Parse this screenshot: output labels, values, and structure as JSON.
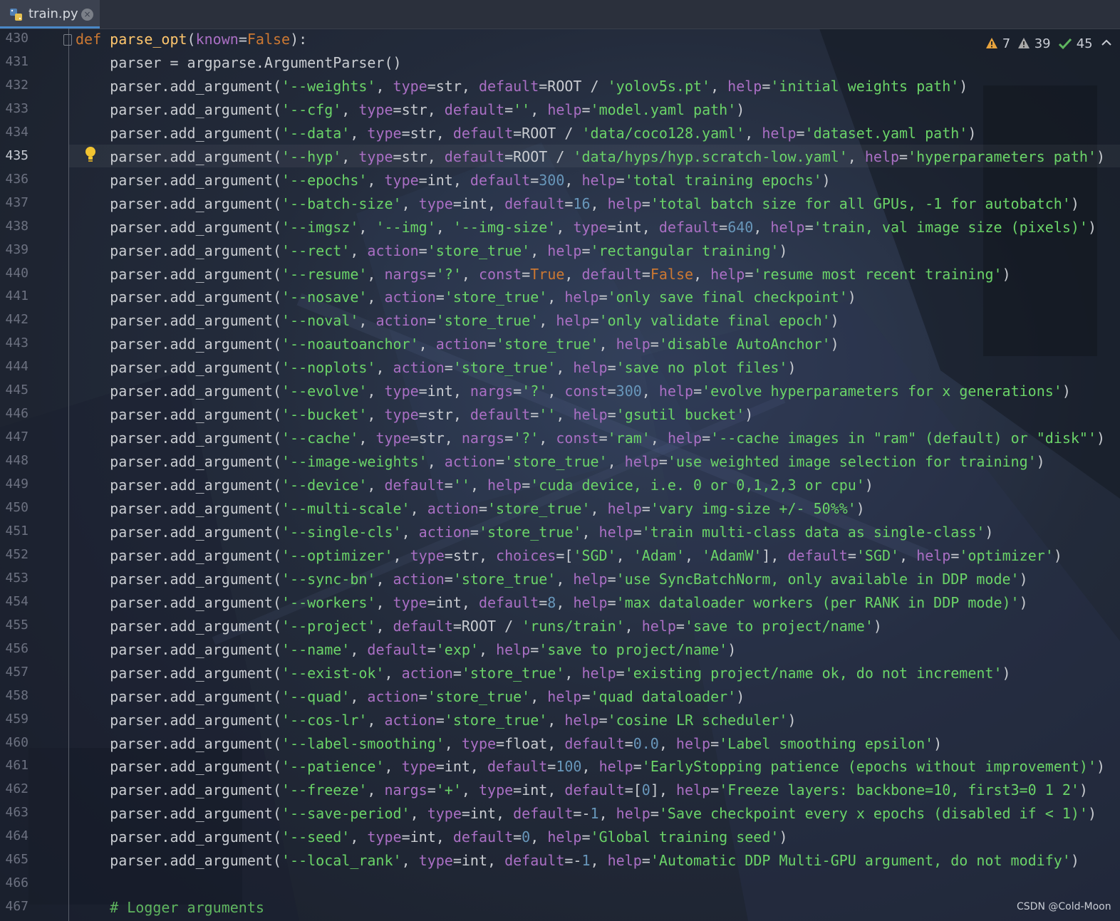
{
  "tab": {
    "file_name": "train.py",
    "close_glyph": "×",
    "icon": "python-file-icon"
  },
  "inspections": {
    "warnings": "7",
    "weak_warnings": "39",
    "typos": "45"
  },
  "watermark": "CSDN @Cold-Moon",
  "current_line": "435",
  "line_numbers": [
    "430",
    "431",
    "432",
    "433",
    "434",
    "435",
    "436",
    "437",
    "438",
    "439",
    "440",
    "441",
    "442",
    "443",
    "444",
    "445",
    "446",
    "447",
    "448",
    "449",
    "450",
    "451",
    "452",
    "453",
    "454",
    "455",
    "456",
    "457",
    "458",
    "459",
    "460",
    "461",
    "462",
    "463",
    "464",
    "465",
    "466",
    "467"
  ],
  "code_lines": [
    "def parse_opt(known=False):",
    "    parser = argparse.ArgumentParser()",
    "    parser.add_argument('--weights', type=str, default=ROOT / 'yolov5s.pt', help='initial weights path')",
    "    parser.add_argument('--cfg', type=str, default='', help='model.yaml path')",
    "    parser.add_argument('--data', type=str, default=ROOT / 'data/coco128.yaml', help='dataset.yaml path')",
    "    parser.add_argument('--hyp', type=str, default=ROOT / 'data/hyps/hyp.scratch-low.yaml', help='hyperparameters path')",
    "    parser.add_argument('--epochs', type=int, default=300, help='total training epochs')",
    "    parser.add_argument('--batch-size', type=int, default=16, help='total batch size for all GPUs, -1 for autobatch')",
    "    parser.add_argument('--imgsz', '--img', '--img-size', type=int, default=640, help='train, val image size (pixels)')",
    "    parser.add_argument('--rect', action='store_true', help='rectangular training')",
    "    parser.add_argument('--resume', nargs='?', const=True, default=False, help='resume most recent training')",
    "    parser.add_argument('--nosave', action='store_true', help='only save final checkpoint')",
    "    parser.add_argument('--noval', action='store_true', help='only validate final epoch')",
    "    parser.add_argument('--noautoanchor', action='store_true', help='disable AutoAnchor')",
    "    parser.add_argument('--noplots', action='store_true', help='save no plot files')",
    "    parser.add_argument('--evolve', type=int, nargs='?', const=300, help='evolve hyperparameters for x generations')",
    "    parser.add_argument('--bucket', type=str, default='', help='gsutil bucket')",
    "    parser.add_argument('--cache', type=str, nargs='?', const='ram', help='--cache images in \"ram\" (default) or \"disk\"')",
    "    parser.add_argument('--image-weights', action='store_true', help='use weighted image selection for training')",
    "    parser.add_argument('--device', default='', help='cuda device, i.e. 0 or 0,1,2,3 or cpu')",
    "    parser.add_argument('--multi-scale', action='store_true', help='vary img-size +/- 50%%')",
    "    parser.add_argument('--single-cls', action='store_true', help='train multi-class data as single-class')",
    "    parser.add_argument('--optimizer', type=str, choices=['SGD', 'Adam', 'AdamW'], default='SGD', help='optimizer')",
    "    parser.add_argument('--sync-bn', action='store_true', help='use SyncBatchNorm, only available in DDP mode')",
    "    parser.add_argument('--workers', type=int, default=8, help='max dataloader workers (per RANK in DDP mode)')",
    "    parser.add_argument('--project', default=ROOT / 'runs/train', help='save to project/name')",
    "    parser.add_argument('--name', default='exp', help='save to project/name')",
    "    parser.add_argument('--exist-ok', action='store_true', help='existing project/name ok, do not increment')",
    "    parser.add_argument('--quad', action='store_true', help='quad dataloader')",
    "    parser.add_argument('--cos-lr', action='store_true', help='cosine LR scheduler')",
    "    parser.add_argument('--label-smoothing', type=float, default=0.0, help='Label smoothing epsilon')",
    "    parser.add_argument('--patience', type=int, default=100, help='EarlyStopping patience (epochs without improvement)')",
    "    parser.add_argument('--freeze', nargs='+', type=int, default=[0], help='Freeze layers: backbone=10, first3=0 1 2')",
    "    parser.add_argument('--save-period', type=int, default=-1, help='Save checkpoint every x epochs (disabled if < 1)')",
    "    parser.add_argument('--seed', type=int, default=0, help='Global training seed')",
    "    parser.add_argument('--local_rank', type=int, default=-1, help='Automatic DDP Multi-GPU argument, do not modify')",
    "",
    "    # Logger arguments"
  ],
  "colors": {
    "keyword": "#cc7832",
    "function": "#ffc66d",
    "string": "#6bd468",
    "kwarg": "#aa6fc4",
    "number": "#6897bb",
    "comment": "#5fb65f",
    "text": "#c9ccd1"
  }
}
